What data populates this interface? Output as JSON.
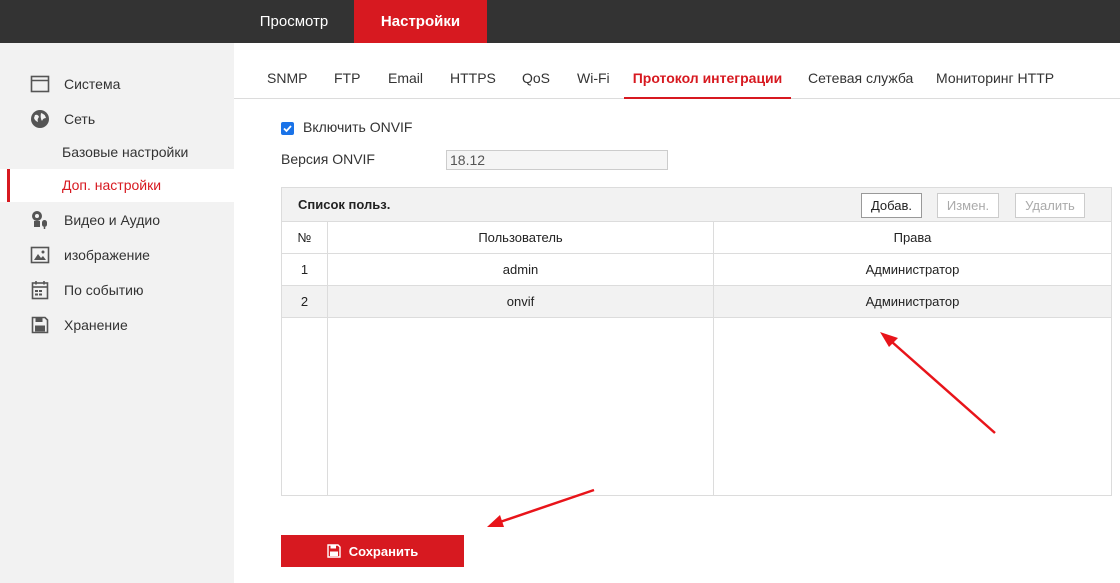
{
  "topnav": {
    "preview": "Просмотр",
    "settings": "Настройки"
  },
  "sidebar": {
    "items": [
      {
        "label": "Система",
        "icon": "monitor-icon"
      },
      {
        "label": "Сеть",
        "icon": "globe-icon"
      },
      {
        "label": "Видео и Аудио",
        "icon": "camera-mic-icon"
      },
      {
        "label": "изображение",
        "icon": "image-icon"
      },
      {
        "label": "По событию",
        "icon": "calendar-icon"
      },
      {
        "label": "Хранение",
        "icon": "floppy-icon"
      }
    ],
    "subitems": [
      {
        "label": "Базовые настройки"
      },
      {
        "label": "Доп. настройки"
      }
    ]
  },
  "tabs": [
    "SNMP",
    "FTP",
    "Email",
    "HTTPS",
    "QoS",
    "Wi-Fi",
    "Протокол интеграции",
    "Сетевая служба",
    "Мониторинг HTTP"
  ],
  "form": {
    "enable_label": "Включить ONVIF",
    "enable_checked": true,
    "version_label": "Версия ONVIF",
    "version_value": "18.12"
  },
  "userlist": {
    "title": "Список польз.",
    "add": "Добав.",
    "edit": "Измен.",
    "delete": "Удалить",
    "columns": [
      "№",
      "Пользователь",
      "Права"
    ],
    "rows": [
      {
        "no": "1",
        "user": "admin",
        "rights": "Администратор"
      },
      {
        "no": "2",
        "user": "onvif",
        "rights": "Администратор"
      }
    ]
  },
  "save_label": "Сохранить",
  "colors": {
    "accent": "#d71920",
    "topbar": "#333333",
    "sidebar": "#f2f2f2",
    "annotation": "#e8141a"
  }
}
